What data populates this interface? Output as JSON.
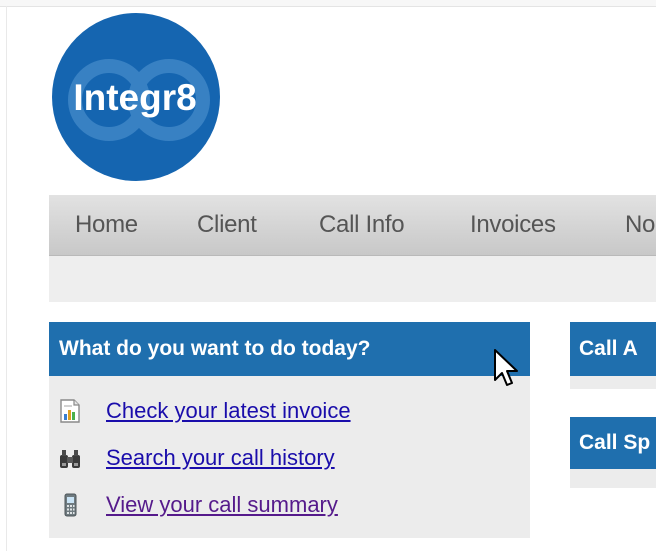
{
  "logo": {
    "text": "Integr8"
  },
  "nav": {
    "items": [
      {
        "label": "Home"
      },
      {
        "label": "Client"
      },
      {
        "label": "Call Info"
      },
      {
        "label": "Invoices"
      },
      {
        "label": "No"
      }
    ]
  },
  "main_panel": {
    "title": "What do you want to do today?",
    "links": [
      {
        "label": "Check your latest invoice",
        "icon": "invoice-icon"
      },
      {
        "label": "Search your call history",
        "icon": "binoculars-icon"
      },
      {
        "label": "View your call summary",
        "icon": "phone-icon"
      }
    ]
  },
  "side_panels": [
    {
      "title": "Call A"
    },
    {
      "title": "Call Sp"
    }
  ],
  "colors": {
    "brand_blue": "#1f6fae",
    "logo_blue": "#1565b0",
    "nav_text": "#555555",
    "link": "#1a0dab",
    "link_visited": "#551a8b"
  }
}
